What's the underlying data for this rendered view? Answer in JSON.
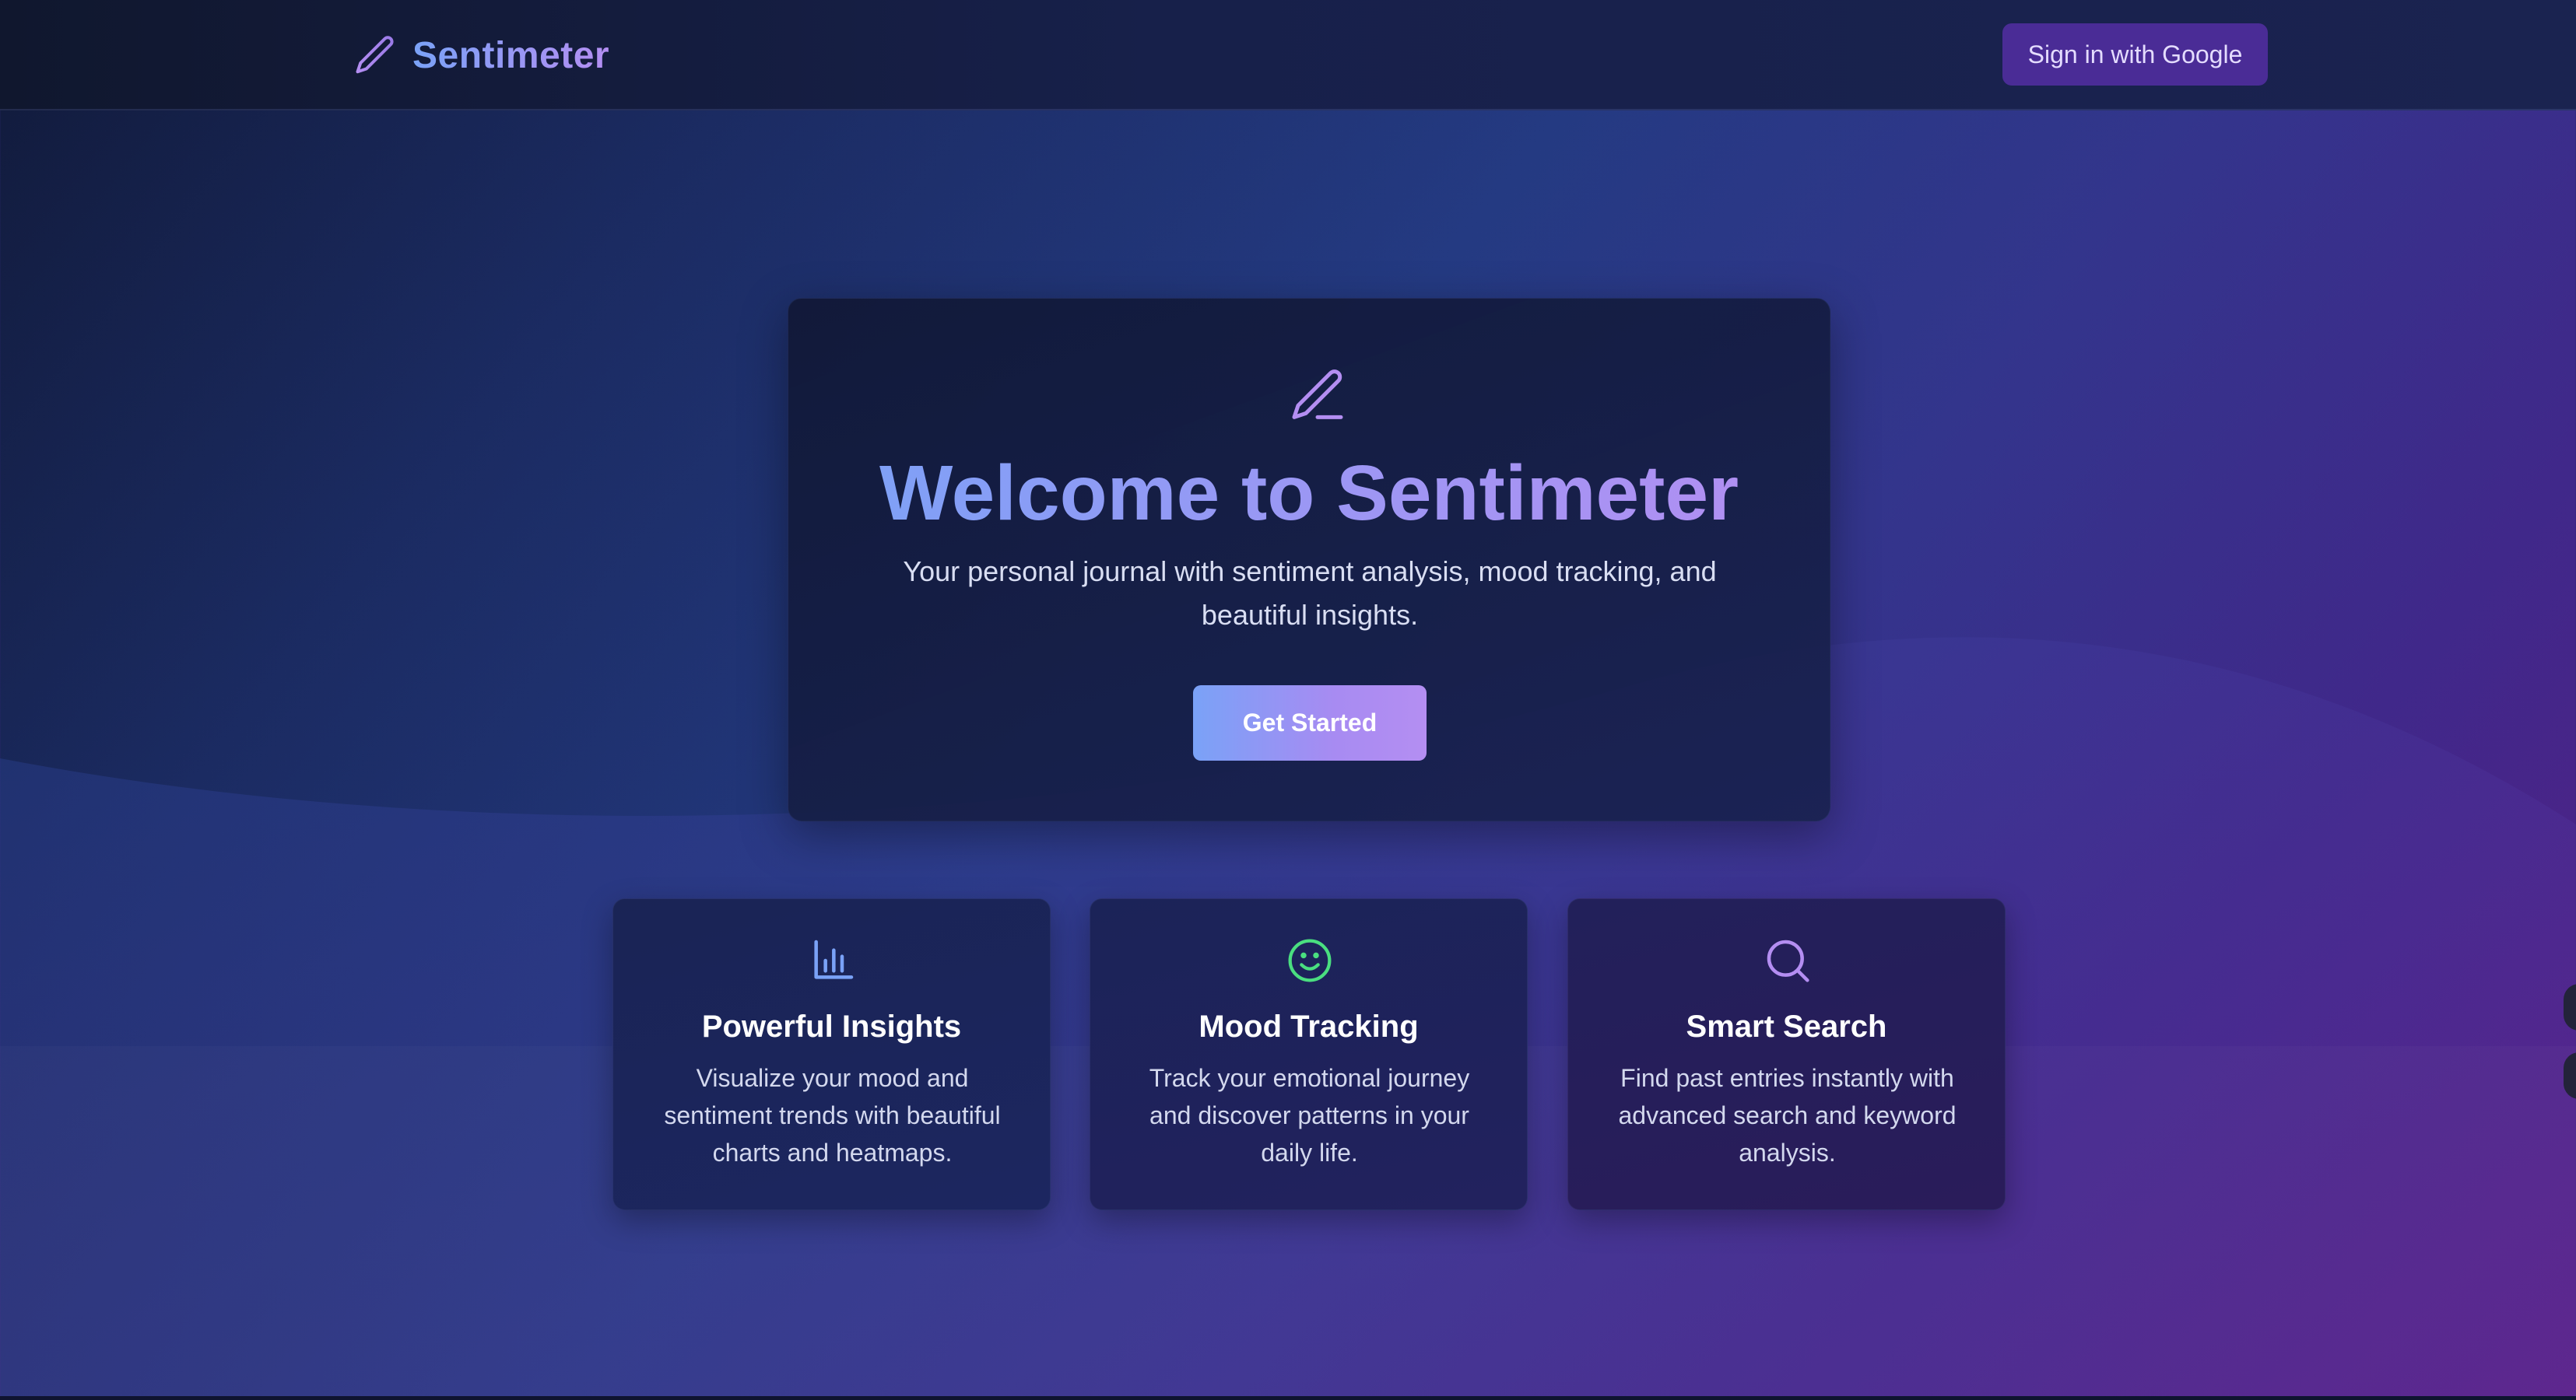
{
  "header": {
    "brand_name": "Sentimeter",
    "brand_icon": "pencil-icon",
    "signin_label": "Sign in with Google"
  },
  "hero": {
    "icon": "pencil-icon",
    "title": "Welcome to Sentimeter",
    "subtitle": "Your personal journal with sentiment analysis, mood tracking, and beautiful insights.",
    "cta_label": "Get Started"
  },
  "features": [
    {
      "icon": "bar-chart-icon",
      "title": "Powerful Insights",
      "description": "Visualize your mood and sentiment trends with beautiful charts and heatmaps."
    },
    {
      "icon": "smile-icon",
      "title": "Mood Tracking",
      "description": "Track your emotional journey and discover patterns in your daily life."
    },
    {
      "icon": "search-icon",
      "title": "Smart Search",
      "description": "Find past entries instantly with advanced search and keyword analysis."
    }
  ],
  "colors": {
    "accent_blue": "#7aa2f7",
    "accent_purple": "#b48ef2",
    "signin_bg": "#4a2c96",
    "mood_green": "#4ade80"
  }
}
